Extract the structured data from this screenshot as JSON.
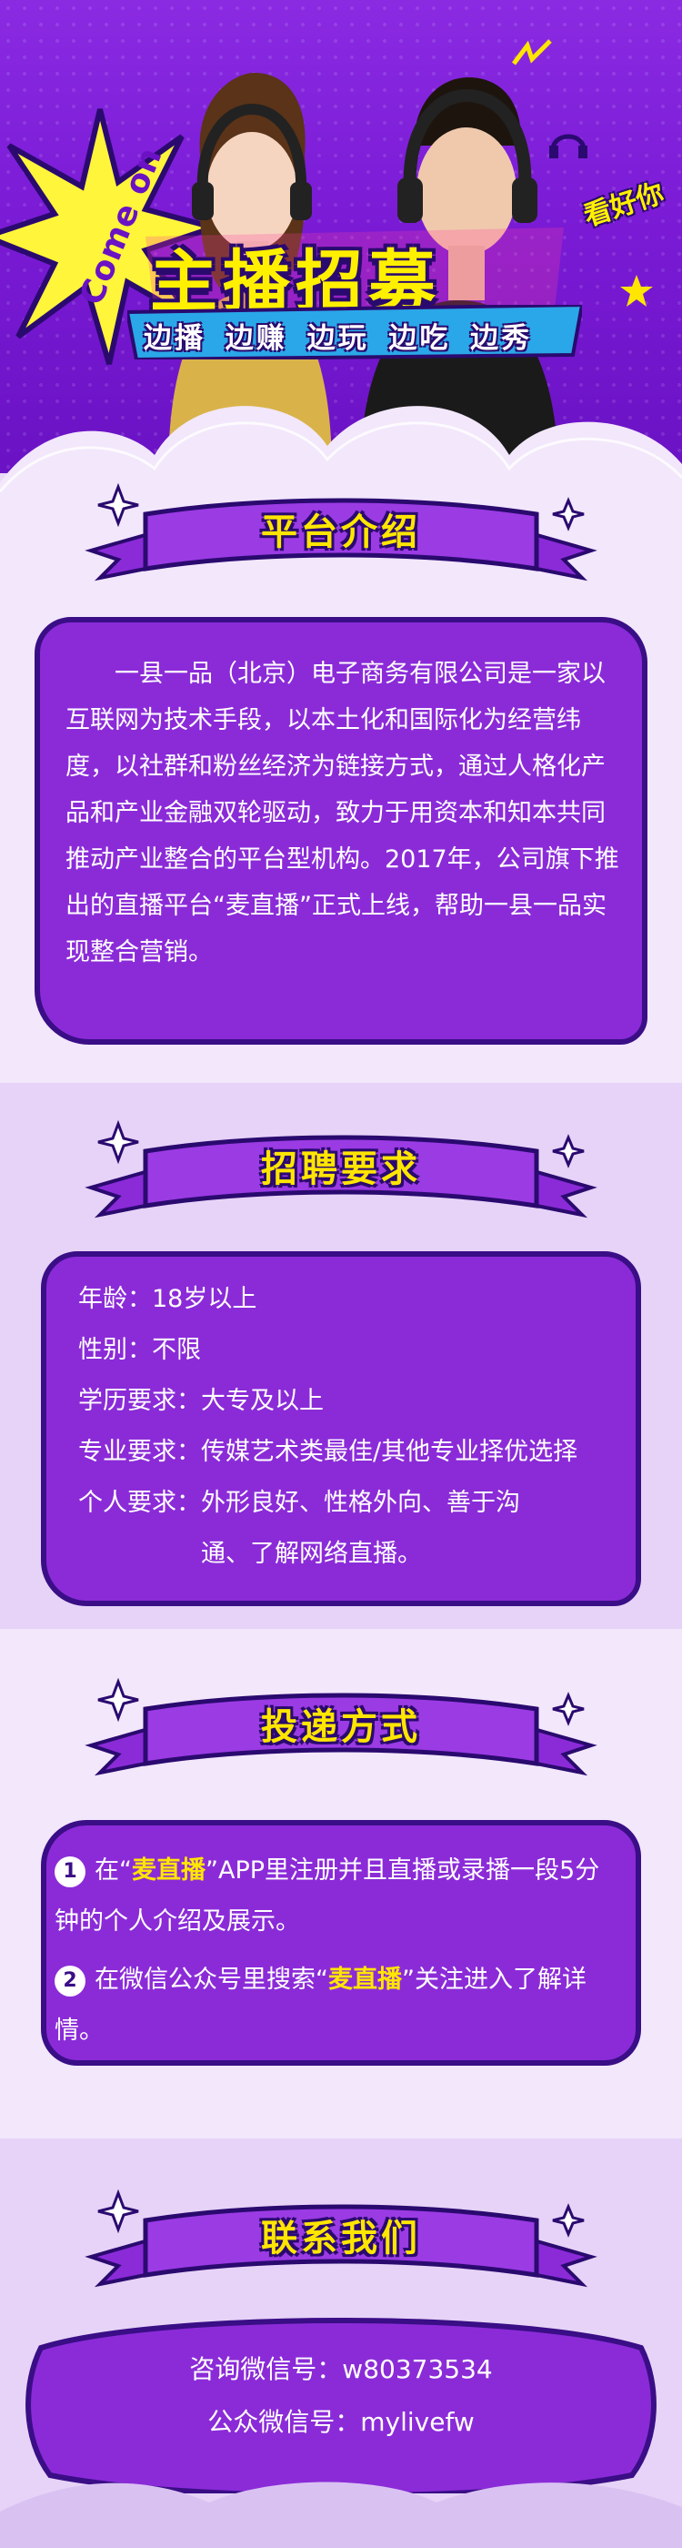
{
  "hero": {
    "come_on": "Come on",
    "title": "主播招募",
    "subtitle": "边播 边赚 边玩 边吃 边秀",
    "tag": "看好你"
  },
  "sections": {
    "intro": {
      "title": "平台介绍",
      "text": "一县一品（北京）电子商务有限公司是一家以互联网为技术手段，以本土化和国际化为经营纬度，以社群和粉丝经济为链接方式，通过人格化产品和产业金融双轮驱动，致力于用资本和知本共同推动产业整合的平台型机构。2017年，公司旗下推出的直播平台“麦直播”正式上线，帮助一县一品实现整合营销。"
    },
    "requirements": {
      "title": "招聘要求",
      "items": [
        {
          "label": "年龄：",
          "value": "18岁以上"
        },
        {
          "label": "性别：",
          "value": "不限"
        },
        {
          "label": "学历要求：",
          "value": "大专及以上"
        },
        {
          "label": "专业要求：",
          "value": "传媒艺术类最佳/其他专业择优选择"
        },
        {
          "label": "个人要求：",
          "value": "外形良好、性格外向、善于沟通、了解网络直播。"
        }
      ]
    },
    "apply": {
      "title": "投递方式",
      "steps": [
        {
          "num": "1",
          "pre": "在“",
          "hl": "麦直播",
          "post": "”APP里注册并且直播或录播一段5分钟的个人介绍及展示。"
        },
        {
          "num": "2",
          "pre": "在微信公众号里搜索“",
          "hl": "麦直播",
          "post": "”关注进入了解详情。"
        }
      ]
    },
    "contact": {
      "title": "联系我们",
      "lines": [
        {
          "label": "咨询微信号：",
          "value": "w80373534"
        },
        {
          "label": "公众微信号：",
          "value": "mylivefw"
        }
      ]
    }
  },
  "colors": {
    "purple_main": "#8b2bd8",
    "purple_dark": "#3a0e86",
    "yellow": "#ffe600",
    "bg": "#e9d9f7"
  }
}
